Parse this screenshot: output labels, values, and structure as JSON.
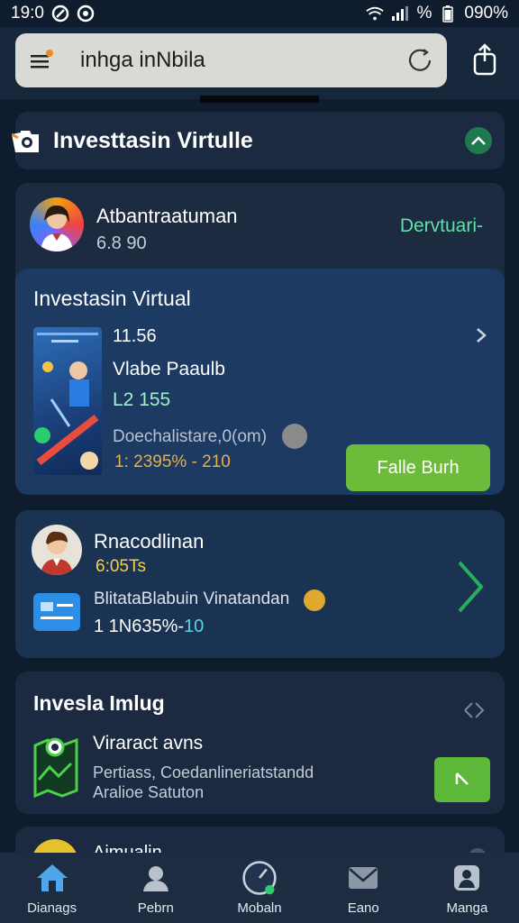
{
  "status_bar": {
    "time": "19:0",
    "battery": "%",
    "battery_level": "090%"
  },
  "search": {
    "query": "inhga inNbila"
  },
  "header_card": {
    "title": "Investtasin Virtulle"
  },
  "profile": {
    "name": "Atbantraatuman",
    "value": "6.8 90",
    "badge": "Dervtuari-"
  },
  "invest_panel": {
    "title": "Investasin Virtual",
    "line1": "11.56",
    "line2": "Vlabe Paaulb",
    "line3": "L2 155",
    "line4": "Doechalistare,0(om)",
    "line5": "1: 2395% - 210",
    "button_label": "Falle Burh"
  },
  "card3": {
    "name": "Rnacodlinan",
    "value": "6:05Ts",
    "description": "BlitataBlabuin Vinatandan",
    "pct_prefix": "1 1N635%-",
    "pct_highlight": "10"
  },
  "card4": {
    "title": "Invesla Imlug",
    "subtitle": "Viraract avns",
    "desc1": "Pertiass, Coedanlineriatstandd",
    "desc2": "Aralioe Satuton"
  },
  "card5": {
    "name": "Ajmualin"
  },
  "nav": [
    {
      "label": "Dianags",
      "icon": "home-icon"
    },
    {
      "label": "Pebrn",
      "icon": "user-icon"
    },
    {
      "label": "Mobaln",
      "icon": "gauge-icon"
    },
    {
      "label": "Eano",
      "icon": "mail-icon"
    },
    {
      "label": "Manga",
      "icon": "profile-icon"
    }
  ],
  "colors": {
    "background": "#0f1c2e",
    "card": "#1b2a40",
    "accent_green": "#6dbb3a",
    "teal_text": "#5fe0a8",
    "gold_text": "#e8b04a"
  }
}
